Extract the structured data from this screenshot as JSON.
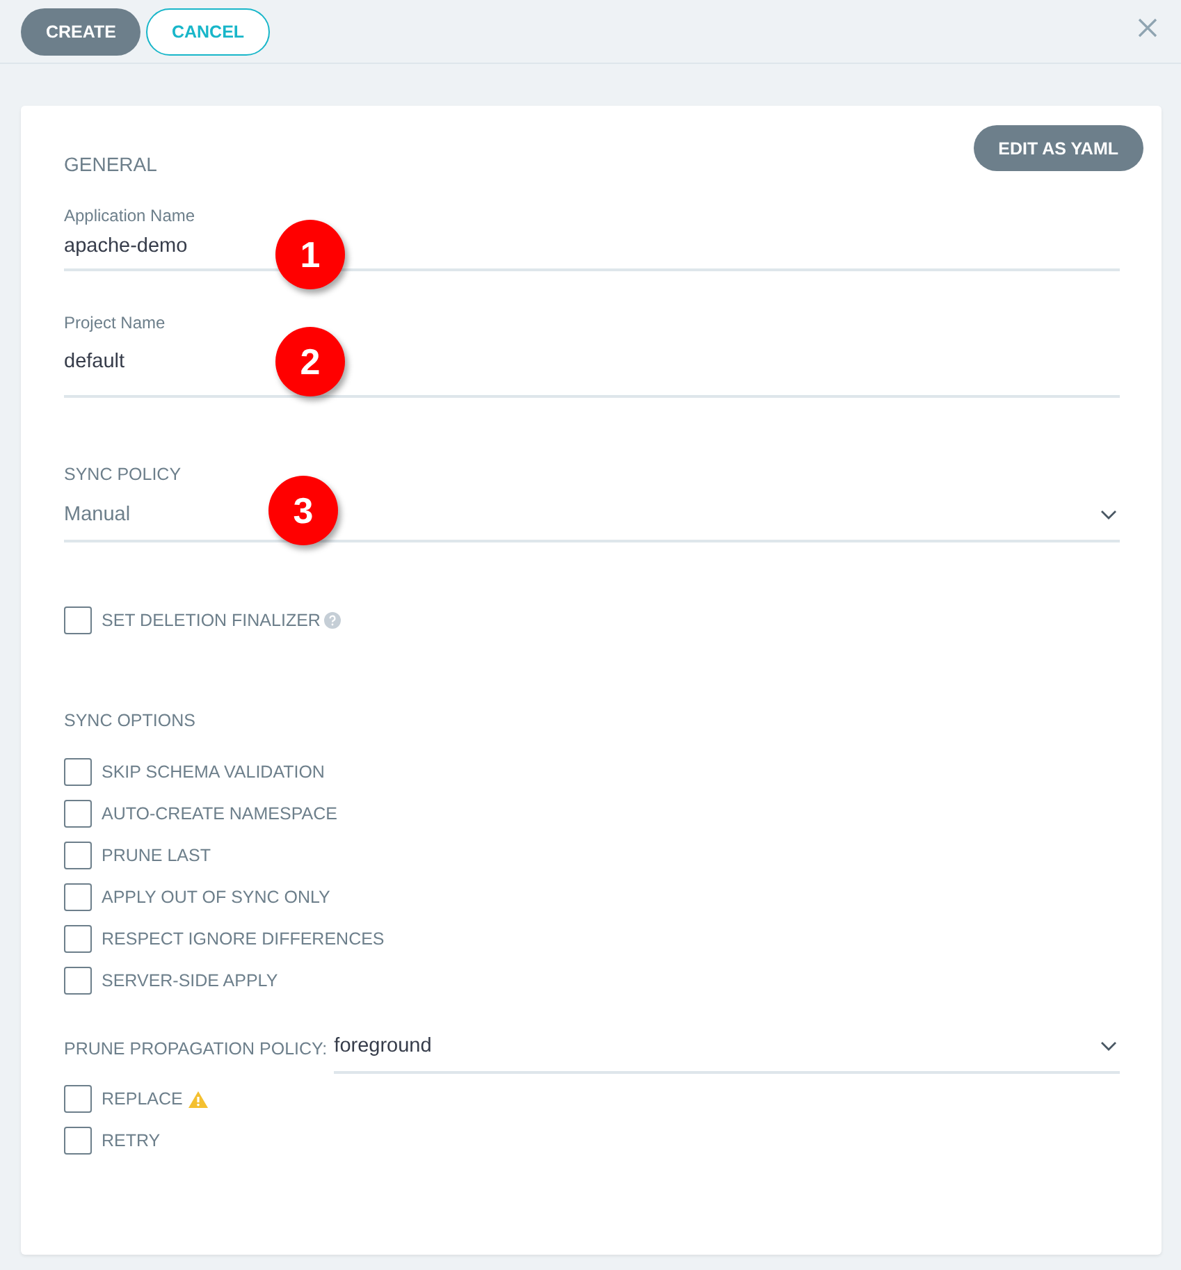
{
  "toolbar": {
    "buttons": [
      {
        "label": "CREATE",
        "kind": "primary"
      },
      {
        "label": "CANCEL",
        "kind": "outline"
      }
    ]
  },
  "card": {
    "edit_button": "EDIT AS YAML",
    "section_title": "GENERAL",
    "fields": [
      {
        "label": "Application Name",
        "value": "apache-demo",
        "marker": "1"
      },
      {
        "label": "Project Name",
        "value": "default",
        "marker": "2"
      }
    ],
    "sync_policy": {
      "label": "SYNC POLICY",
      "value": "Manual",
      "marker": "3"
    },
    "finalizer": {
      "label": "SET DELETION FINALIZER",
      "checked": false
    },
    "sync_options": {
      "title": "SYNC OPTIONS",
      "options": [
        {
          "label": "SKIP SCHEMA VALIDATION",
          "checked": false
        },
        {
          "label": "AUTO-CREATE NAMESPACE",
          "checked": false
        },
        {
          "label": "PRUNE LAST",
          "checked": false
        },
        {
          "label": "APPLY OUT OF SYNC ONLY",
          "checked": false
        },
        {
          "label": "RESPECT IGNORE DIFFERENCES",
          "checked": false
        },
        {
          "label": "SERVER-SIDE APPLY",
          "checked": false
        }
      ]
    },
    "prune_policy": {
      "label": "PRUNE PROPAGATION POLICY:",
      "value": "foreground"
    },
    "extra_options": [
      {
        "label": "REPLACE",
        "checked": false,
        "warning": true
      },
      {
        "label": "RETRY",
        "checked": false,
        "warning": false
      }
    ]
  }
}
